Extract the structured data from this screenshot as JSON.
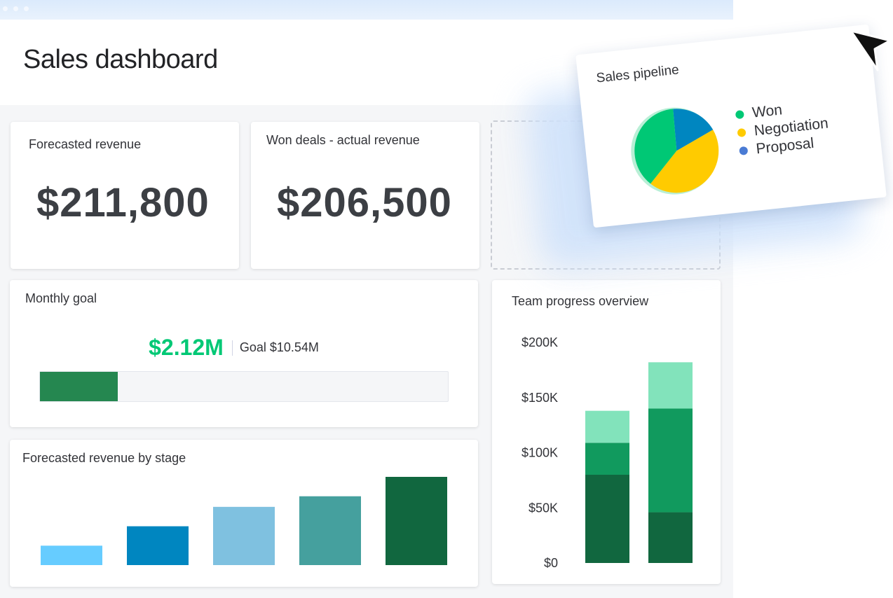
{
  "page": {
    "title": "Sales dashboard"
  },
  "kpis": [
    {
      "title": "Forecasted revenue",
      "value": "$211,800"
    },
    {
      "title": "Won deals - actual revenue",
      "value": "$206,500"
    }
  ],
  "monthly_goal": {
    "title": "Monthly goal",
    "current": "$2.12M",
    "goal_text": "Goal $10.54M",
    "progress_fraction": 0.19,
    "fill_color": "#258750"
  },
  "stage_chart": {
    "title": "Forecasted revenue by stage"
  },
  "team_progress": {
    "title": "Team progress overview"
  },
  "sales_pipeline": {
    "title": "Sales pipeline",
    "legend": [
      {
        "label": "Won",
        "color": "#00c875"
      },
      {
        "label": "Negotiation",
        "color": "#ffcb00"
      },
      {
        "label": "Proposal",
        "color": "#0086c0"
      }
    ]
  },
  "chart_data": [
    {
      "type": "bar",
      "title": "Forecasted revenue by stage",
      "categories": [
        "",
        "",
        "",
        "",
        ""
      ],
      "values": [
        0.22,
        0.44,
        0.66,
        0.78,
        1.0
      ],
      "colors": [
        "#66ccff",
        "#0086c0",
        "#7fc1e0",
        "#45a09e",
        "#11673f"
      ]
    },
    {
      "type": "bar",
      "stacked": true,
      "title": "Team progress overview",
      "ylim": [
        0,
        200000
      ],
      "yticks": [
        "$0",
        "$50K",
        "$100K",
        "$150K",
        "$200K"
      ],
      "ytick_values": [
        0,
        50000,
        100000,
        150000,
        200000
      ],
      "categories": [
        "",
        ""
      ],
      "series": [
        {
          "values": [
            80000,
            46000
          ],
          "color": "#11673f"
        },
        {
          "values": [
            29000,
            94000
          ],
          "color": "#119a5e"
        },
        {
          "values": [
            29000,
            42000
          ],
          "color": "#82e3bb"
        }
      ]
    },
    {
      "type": "pie",
      "title": "Sales pipeline",
      "categories": [
        "Won",
        "Negotiation",
        "Proposal"
      ],
      "values": [
        38,
        44,
        18
      ],
      "colors": [
        "#00c875",
        "#ffcb00",
        "#0086c0"
      ]
    }
  ]
}
